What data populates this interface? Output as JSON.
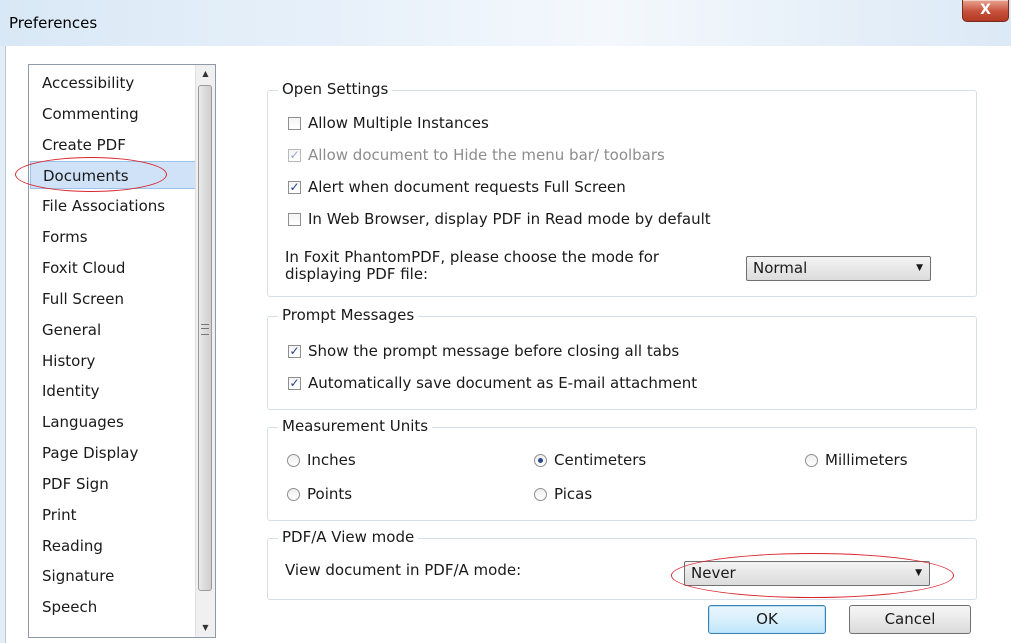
{
  "window": {
    "title": "Preferences",
    "close_label": "X"
  },
  "categories": [
    {
      "label": "Accessibility"
    },
    {
      "label": "Commenting"
    },
    {
      "label": "Create PDF"
    },
    {
      "label": "Documents",
      "selected": true
    },
    {
      "label": "File Associations"
    },
    {
      "label": "Forms"
    },
    {
      "label": "Foxit Cloud"
    },
    {
      "label": "Full Screen"
    },
    {
      "label": "General"
    },
    {
      "label": "History"
    },
    {
      "label": "Identity"
    },
    {
      "label": "Languages"
    },
    {
      "label": "Page Display"
    },
    {
      "label": "PDF Sign"
    },
    {
      "label": "Print"
    },
    {
      "label": "Reading"
    },
    {
      "label": "Signature"
    },
    {
      "label": "Speech"
    }
  ],
  "open_settings": {
    "title": "Open Settings",
    "options": [
      {
        "label": "Allow Multiple Instances",
        "checked": false,
        "enabled": true
      },
      {
        "label": "Allow document to Hide the menu bar/ toolbars",
        "checked": true,
        "enabled": false
      },
      {
        "label": "Alert when document requests Full Screen",
        "checked": true,
        "enabled": true
      },
      {
        "label": "In Web Browser, display PDF in Read mode by default",
        "checked": false,
        "enabled": true
      }
    ],
    "mode_label_line1": "In Foxit PhantomPDF, please choose the mode for",
    "mode_label_line2": "displaying PDF file:",
    "mode_value": "Normal"
  },
  "prompt_messages": {
    "title": "Prompt Messages",
    "options": [
      {
        "label": "Show the prompt message before closing all tabs",
        "checked": true
      },
      {
        "label": "Automatically save document as E-mail attachment",
        "checked": true
      }
    ]
  },
  "measurement_units": {
    "title": "Measurement Units",
    "options": [
      {
        "label": "Inches",
        "selected": false
      },
      {
        "label": "Centimeters",
        "selected": true
      },
      {
        "label": "Millimeters",
        "selected": false
      },
      {
        "label": "Points",
        "selected": false
      },
      {
        "label": "Picas",
        "selected": false
      }
    ]
  },
  "pdfa": {
    "title": "PDF/A View mode",
    "label": "View document in PDF/A mode:",
    "value": "Never"
  },
  "buttons": {
    "ok": "OK",
    "cancel": "Cancel"
  },
  "annotation_color": "#d8262e"
}
